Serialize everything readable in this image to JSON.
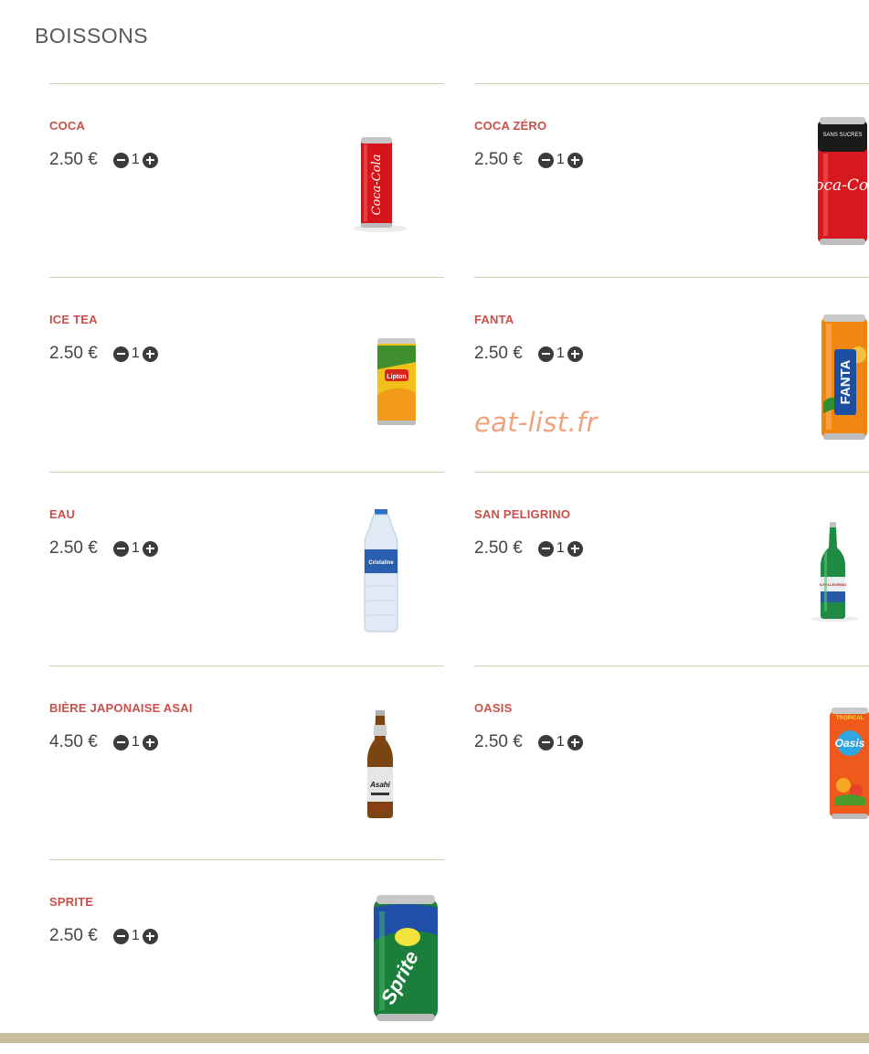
{
  "section": {
    "title": "BOISSONS"
  },
  "items": [
    {
      "name": "COCA",
      "price": "2.50 €",
      "qty": "1",
      "image_icon": "red-can-icon",
      "image_text": "Coca-Cola"
    },
    {
      "name": "COCA ZÉRO",
      "price": "2.50 €",
      "qty": "1",
      "image_icon": "red-black-can-icon",
      "image_text": "Coca-Cola"
    },
    {
      "name": "ICE TEA",
      "price": "2.50 €",
      "qty": "1",
      "image_icon": "yellow-can-icon",
      "image_text": "Lipton"
    },
    {
      "name": "FANTA",
      "price": "2.50 €",
      "qty": "1",
      "image_icon": "orange-can-icon",
      "image_text": "FANTA"
    },
    {
      "name": "EAU",
      "price": "2.50 €",
      "qty": "1",
      "image_icon": "water-bottle-icon",
      "image_text": "Cristaline"
    },
    {
      "name": "SAN PELIGRINO",
      "price": "2.50 €",
      "qty": "1",
      "image_icon": "green-bottle-icon",
      "image_text": "S.PELLEGRINO"
    },
    {
      "name": "BIÈRE JAPONAISE ASAI",
      "price": "4.50 €",
      "qty": "1",
      "image_icon": "beer-bottle-icon",
      "image_text": "Asahi"
    },
    {
      "name": "OASIS",
      "price": "2.50 €",
      "qty": "1",
      "image_icon": "orange-oasis-can-icon",
      "image_text": "Oasis"
    },
    {
      "name": "SPRITE",
      "price": "2.50 €",
      "qty": "1",
      "image_icon": "green-can-icon",
      "image_text": "Sprite"
    }
  ],
  "watermark": "eat-list.fr",
  "colors": {
    "item_name": "#c9504a",
    "divider": "#d9cdb6",
    "footer": "#c6bd9d",
    "watermark": "#f0a37c"
  }
}
